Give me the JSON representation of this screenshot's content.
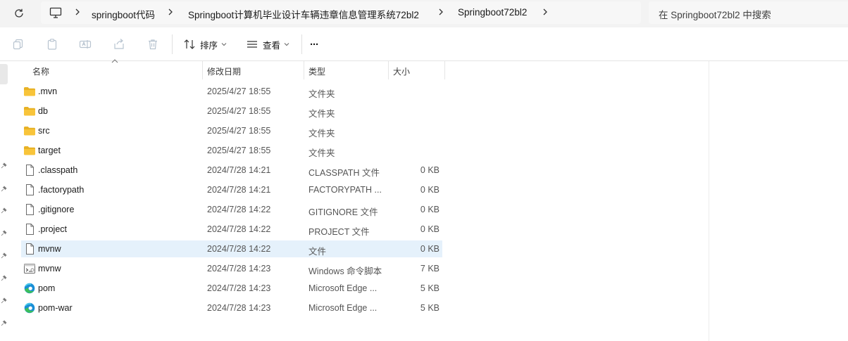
{
  "breadcrumbs": [
    {
      "label": "springboot代码"
    },
    {
      "label": "Springboot计算机毕业设计车辆违章信息管理系统72bl2"
    },
    {
      "label": "Springboot72bl2"
    }
  ],
  "search": {
    "placeholder": "在 Springboot72bl2 中搜索"
  },
  "toolbar": {
    "sort_label": "排序",
    "view_label": "查看",
    "more_label": "···"
  },
  "columns": {
    "name": "名称",
    "modified": "修改日期",
    "type": "类型",
    "size": "大小"
  },
  "files": [
    {
      "name": ".mvn",
      "modified": "2025/4/27 18:55",
      "type": "文件夹",
      "size": "",
      "icon": "folder-icon"
    },
    {
      "name": "db",
      "modified": "2025/4/27 18:55",
      "type": "文件夹",
      "size": "",
      "icon": "folder-icon"
    },
    {
      "name": "src",
      "modified": "2025/4/27 18:55",
      "type": "文件夹",
      "size": "",
      "icon": "folder-icon"
    },
    {
      "name": "target",
      "modified": "2025/4/27 18:55",
      "type": "文件夹",
      "size": "",
      "icon": "folder-icon"
    },
    {
      "name": ".classpath",
      "modified": "2024/7/28 14:21",
      "type": "CLASSPATH 文件",
      "size": "0 KB",
      "icon": "file-icon"
    },
    {
      "name": ".factorypath",
      "modified": "2024/7/28 14:21",
      "type": "FACTORYPATH ...",
      "size": "0 KB",
      "icon": "file-icon"
    },
    {
      "name": ".gitignore",
      "modified": "2024/7/28 14:22",
      "type": "GITIGNORE 文件",
      "size": "0 KB",
      "icon": "file-icon"
    },
    {
      "name": ".project",
      "modified": "2024/7/28 14:22",
      "type": "PROJECT 文件",
      "size": "0 KB",
      "icon": "file-icon"
    },
    {
      "name": "mvnw",
      "modified": "2024/7/28 14:22",
      "type": "文件",
      "size": "0 KB",
      "icon": "file-icon",
      "selected": true
    },
    {
      "name": "mvnw",
      "modified": "2024/7/28 14:23",
      "type": "Windows 命令脚本",
      "size": "7 KB",
      "icon": "script-icon"
    },
    {
      "name": "pom",
      "modified": "2024/7/28 14:23",
      "type": "Microsoft Edge ...",
      "size": "5 KB",
      "icon": "edge-icon"
    },
    {
      "name": "pom-war",
      "modified": "2024/7/28 14:23",
      "type": "Microsoft Edge ...",
      "size": "5 KB",
      "icon": "edge-icon"
    }
  ],
  "colors": {
    "selected_row": "#e5f1fb",
    "folder": "#f8c43a",
    "edge_blue": "#1a8fd6",
    "edge_green": "#3cbf5a"
  }
}
